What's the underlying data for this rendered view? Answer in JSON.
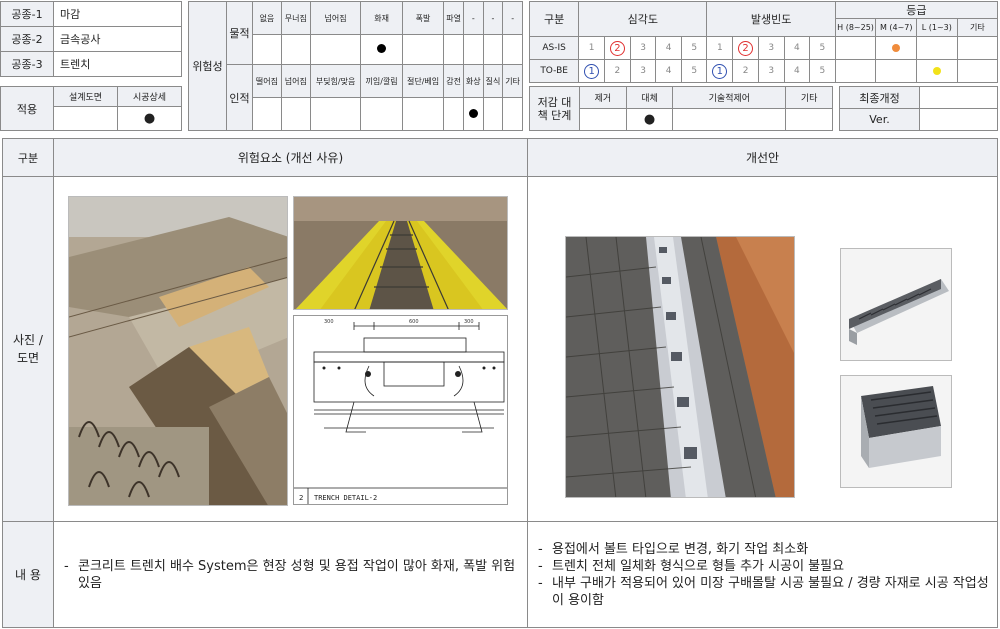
{
  "work_types": [
    {
      "label": "공종-1",
      "value": "마감"
    },
    {
      "label": "공종-2",
      "value": "금속공사"
    },
    {
      "label": "공종-3",
      "value": "트렌치"
    }
  ],
  "apply": {
    "label": "적용",
    "col1": "설계도면",
    "col2": "시공상세",
    "mark1": "",
    "mark2": "●"
  },
  "hazard": {
    "label": "위험성",
    "physical_label": "물적",
    "physical_items": [
      "없음",
      "무너짐",
      "넘어짐",
      "화재",
      "폭발",
      "파열",
      "-",
      "-",
      "-"
    ],
    "human_label": "인적",
    "human_items": [
      "떨어짐",
      "넘어짐",
      "부딪힘/맞음",
      "끼임/깔림",
      "절단/베임",
      "감전",
      "화상",
      "질식",
      "기타"
    ]
  },
  "eval": {
    "label": "구분",
    "severity": "심각도",
    "frequency": "발생빈도",
    "grade": "등급",
    "grade_cols": [
      "H (8~25)",
      "M (4~7)",
      "L (1~3)",
      "기타"
    ],
    "rows": [
      {
        "name": "AS-IS",
        "nums": [
          "1",
          "2",
          "3",
          "4",
          "5"
        ],
        "sev_circled": "2",
        "freq_circled": "2"
      },
      {
        "name": "TO-BE",
        "nums": [
          "1",
          "2",
          "3",
          "4",
          "5"
        ],
        "sev_circled": "1",
        "freq_circled": "1"
      }
    ]
  },
  "reduce": {
    "label": "저감 대책 단계",
    "cols": [
      "제거",
      "대체",
      "기술적제어",
      "기타"
    ],
    "marks": [
      "",
      "●",
      "",
      ""
    ]
  },
  "revision": {
    "label": "최종개정",
    "ver": "Ver.",
    "value": ""
  },
  "main": {
    "col_label": "구분",
    "risk_header": "위험요소 (개선 사유)",
    "improve_header": "개선안",
    "photo_label": "사진 / 도면",
    "content_label": "내 용",
    "drawing_label": "TRENCH DETAIL-2",
    "drawing_num": "2",
    "drawing_dims": [
      "300",
      "600",
      "300"
    ],
    "risk_text": [
      "콘크리트 트렌치 배수 System은 현장 성형 및 용접 작업이 많아 화재, 폭발 위험 있음"
    ],
    "improve_text": [
      "용접에서 볼트 타입으로 변경, 화기 작업 최소화",
      "트렌치 전체 일체화 형식으로 형틀 추가 시공이 불필요",
      "내부 구배가 적용되어 있어 미장 구배몰탈 시공 불필요 / 경량 자재로 시공 작업성이 용이함"
    ]
  }
}
